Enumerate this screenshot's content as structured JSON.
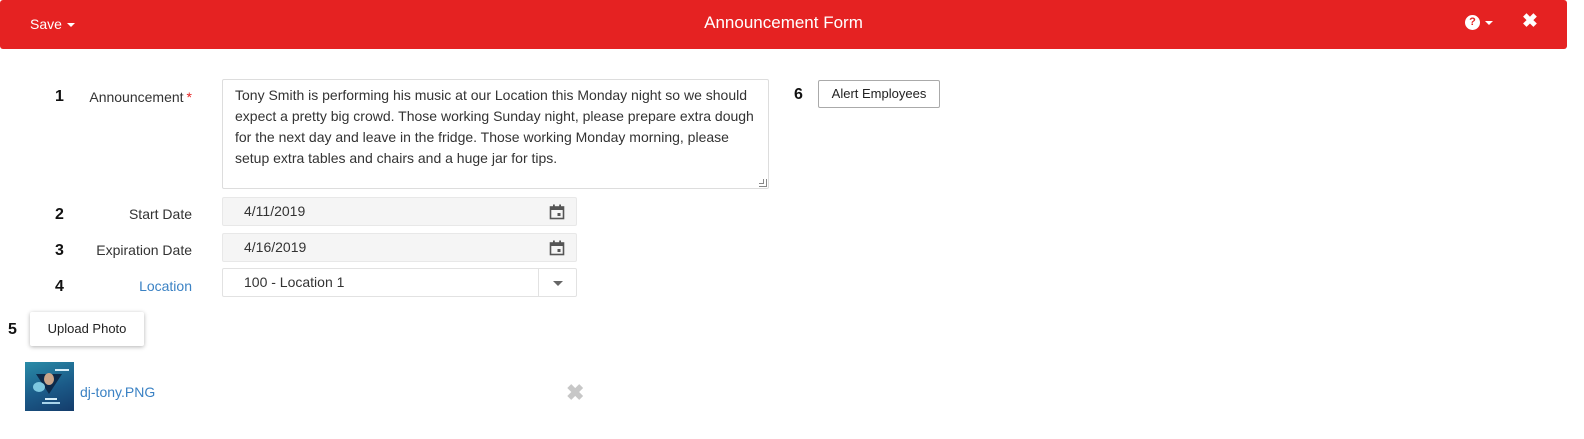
{
  "header": {
    "save_label": "Save",
    "title": "Announcement Form",
    "help_icon": "question-circle-icon",
    "close_icon": "close-icon",
    "brand_color": "#e52222"
  },
  "form": {
    "announcement": {
      "number": "1",
      "label": "Announcement",
      "required_mark": "*",
      "value": "Tony Smith is performing his music at our Location this Monday night so we should expect a pretty big crowd.  Those working Sunday night, please prepare extra dough for the next day and leave in the fridge.  Those working Monday morning, please setup extra tables and chairs and a huge jar for tips."
    },
    "start_date": {
      "number": "2",
      "label": "Start Date",
      "value": "4/11/2019"
    },
    "expiration_date": {
      "number": "3",
      "label": "Expiration Date",
      "value": "4/16/2019"
    },
    "location": {
      "number": "4",
      "label": "Location",
      "value": "100 - Location 1"
    },
    "upload": {
      "number": "5",
      "label": "Upload Photo"
    },
    "alert": {
      "number": "6",
      "label": "Alert Employees"
    }
  },
  "attachment": {
    "file_name": "dj-tony.PNG",
    "remove_icon": "remove-icon"
  }
}
